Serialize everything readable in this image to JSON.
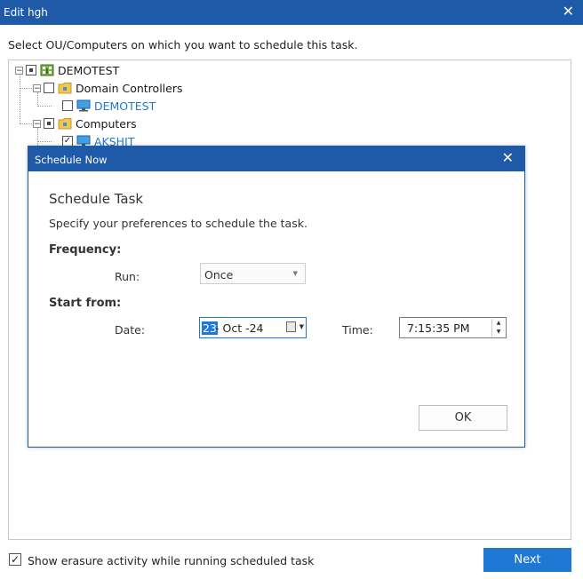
{
  "window": {
    "title": "Edit hgh",
    "close_glyph": "✕"
  },
  "instruction": "Select OU/Computers on which you want to schedule this task.",
  "tree": {
    "root": {
      "label": "DEMOTEST",
      "icon": "domain-icon",
      "state": "partial"
    },
    "groups": [
      {
        "label": "Domain Controllers",
        "icon": "folder-icon",
        "state": "unchecked",
        "children": [
          {
            "label": "DEMOTEST",
            "icon": "computer-icon",
            "state": "unchecked"
          }
        ]
      },
      {
        "label": "Computers",
        "icon": "folder-icon",
        "state": "partial",
        "children": [
          {
            "label": "AKSHIT",
            "icon": "computer-icon",
            "state": "checked"
          }
        ]
      }
    ]
  },
  "dialog": {
    "title": "Schedule Now",
    "close_glyph": "✕",
    "heading": "Schedule Task",
    "description": "Specify your preferences to schedule the task.",
    "frequency_label": "Frequency:",
    "run_label": "Run:",
    "run_value": "Once",
    "start_label": "Start from:",
    "date_label": "Date:",
    "date_day": "23",
    "date_rest": "- Oct -24",
    "time_label": "Time:",
    "time_value": "7:15:35 PM",
    "ok_label": "OK"
  },
  "footer": {
    "show_activity_label": "Show erasure activity while running scheduled task",
    "show_activity_checked": true,
    "next_label": "Next"
  },
  "colors": {
    "accent": "#1e5aa8",
    "link": "#1e78d4"
  }
}
